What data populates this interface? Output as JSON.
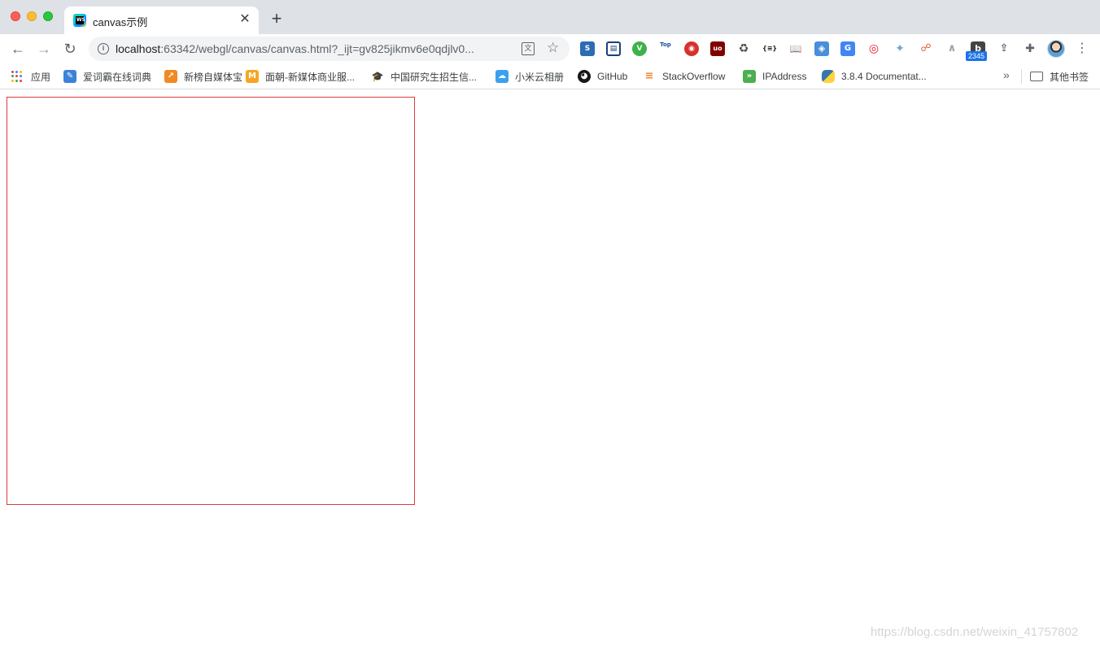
{
  "tab": {
    "title": "canvas示例",
    "close": "✕",
    "new_tab": "+"
  },
  "toolbar": {
    "back": "←",
    "forward": "→",
    "reload": "↻",
    "url_host": "localhost",
    "url_rest": ":63342/webgl/canvas/canvas.html?_ijt=gv825jikmv6e0qdjlv0...",
    "info": "i",
    "star": "☆",
    "menu": "⋮",
    "extension_badge": "2345",
    "extensions": [
      "S",
      "▤",
      "V",
      "Top",
      "◉",
      "uo",
      "♻",
      "{≡}",
      "📖",
      "◈",
      "G",
      "◎",
      "✦",
      "☍",
      "∧",
      "b",
      "⇪",
      "✚"
    ]
  },
  "bookmarks": {
    "items": [
      {
        "label": "应用",
        "icon": "apps-icon"
      },
      {
        "label": "爱词霸在线词典",
        "icon": "iciba-icon"
      },
      {
        "label": "新榜自媒体宝",
        "icon": "newrank-icon"
      },
      {
        "label": "面朝-新媒体商业服...",
        "icon": "m-icon"
      },
      {
        "label": "中国研究生招生信...",
        "icon": "graduation-cap-icon"
      },
      {
        "label": "小米云相册",
        "icon": "cloud-icon"
      },
      {
        "label": "GitHub",
        "icon": "github-icon"
      },
      {
        "label": "StackOverflow",
        "icon": "stackoverflow-icon"
      },
      {
        "label": "IPAddress",
        "icon": "ipaddress-icon"
      },
      {
        "label": "3.8.4 Documentat...",
        "icon": "python-icon"
      }
    ],
    "overflow": "»",
    "other_bookmarks": "其他书签"
  },
  "page": {
    "watermark": "https://blog.csdn.net/weixin_41757802"
  }
}
